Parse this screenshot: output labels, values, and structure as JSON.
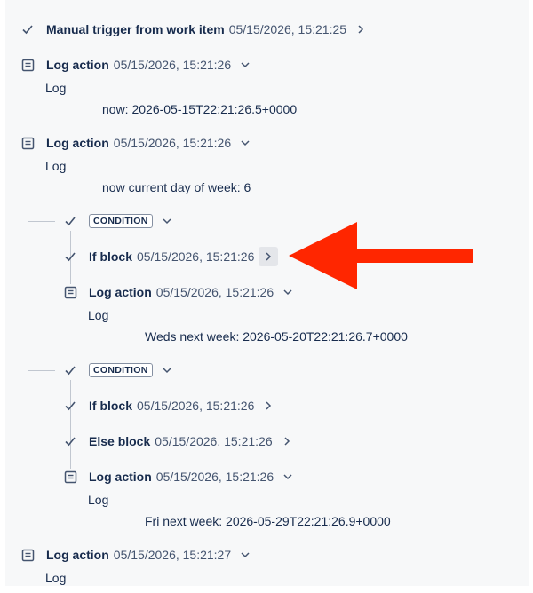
{
  "trigger": {
    "title": "Manual trigger from work item",
    "timestamp": "05/15/2026, 15:21:25"
  },
  "log1": {
    "title": "Log action",
    "timestamp": "05/15/2026, 15:21:26",
    "type": "Log",
    "message": "now: 2026-05-15T22:21:26.5+0000"
  },
  "log2": {
    "title": "Log action",
    "timestamp": "05/15/2026, 15:21:26",
    "type": "Log",
    "message": "now current day of week: 6"
  },
  "cond1": {
    "label": "CONDITION",
    "if_block": {
      "title": "If block",
      "timestamp": "05/15/2026, 15:21:26"
    },
    "log": {
      "title": "Log action",
      "timestamp": "05/15/2026, 15:21:26",
      "type": "Log",
      "message": "Weds next week: 2026-05-20T22:21:26.7+0000"
    }
  },
  "cond2": {
    "label": "CONDITION",
    "if_block": {
      "title": "If block",
      "timestamp": "05/15/2026, 15:21:26"
    },
    "else_block": {
      "title": "Else block",
      "timestamp": "05/15/2026, 15:21:26"
    },
    "log": {
      "title": "Log action",
      "timestamp": "05/15/2026, 15:21:26",
      "type": "Log",
      "message": "Fri next week: 2026-05-29T22:21:26.9+0000"
    }
  },
  "log3": {
    "title": "Log action",
    "timestamp": "05/15/2026, 15:21:27",
    "type": "Log"
  },
  "colors": {
    "arrow": "#ff2600",
    "connector": "#c1c7d0",
    "panel": "#f7f8f9"
  },
  "icons": {
    "check": "check-icon",
    "log": "log-document-icon",
    "expand": "chevron-down-icon",
    "details": "chevron-right-icon"
  }
}
